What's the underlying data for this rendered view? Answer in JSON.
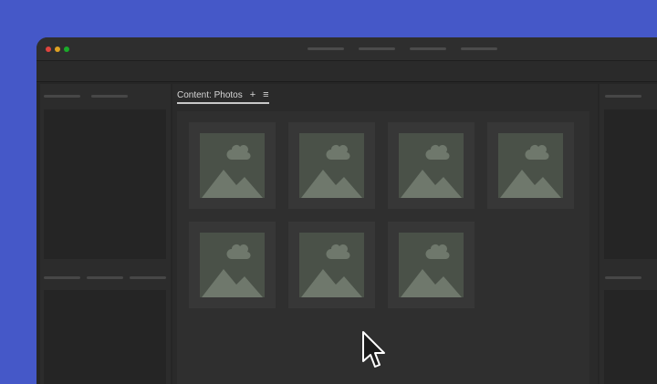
{
  "window": {
    "traffic_lights": {
      "close": "#E0443E",
      "minimize": "#DEA123",
      "maximize": "#1AAB29"
    }
  },
  "content_panel": {
    "tab_title": "Content: Photos",
    "add_icon": "+",
    "menu_icon": "≡"
  },
  "colors": {
    "desktop": "#4558C8",
    "placeholder_image": "#4A5148",
    "placeholder_glyph": "#6F786C"
  },
  "photos": [
    {
      "icon": "image-placeholder-icon"
    },
    {
      "icon": "image-placeholder-icon"
    },
    {
      "icon": "image-placeholder-icon"
    },
    {
      "icon": "image-placeholder-icon"
    },
    {
      "icon": "image-placeholder-icon"
    },
    {
      "icon": "image-placeholder-icon"
    },
    {
      "icon": "image-placeholder-icon"
    }
  ]
}
